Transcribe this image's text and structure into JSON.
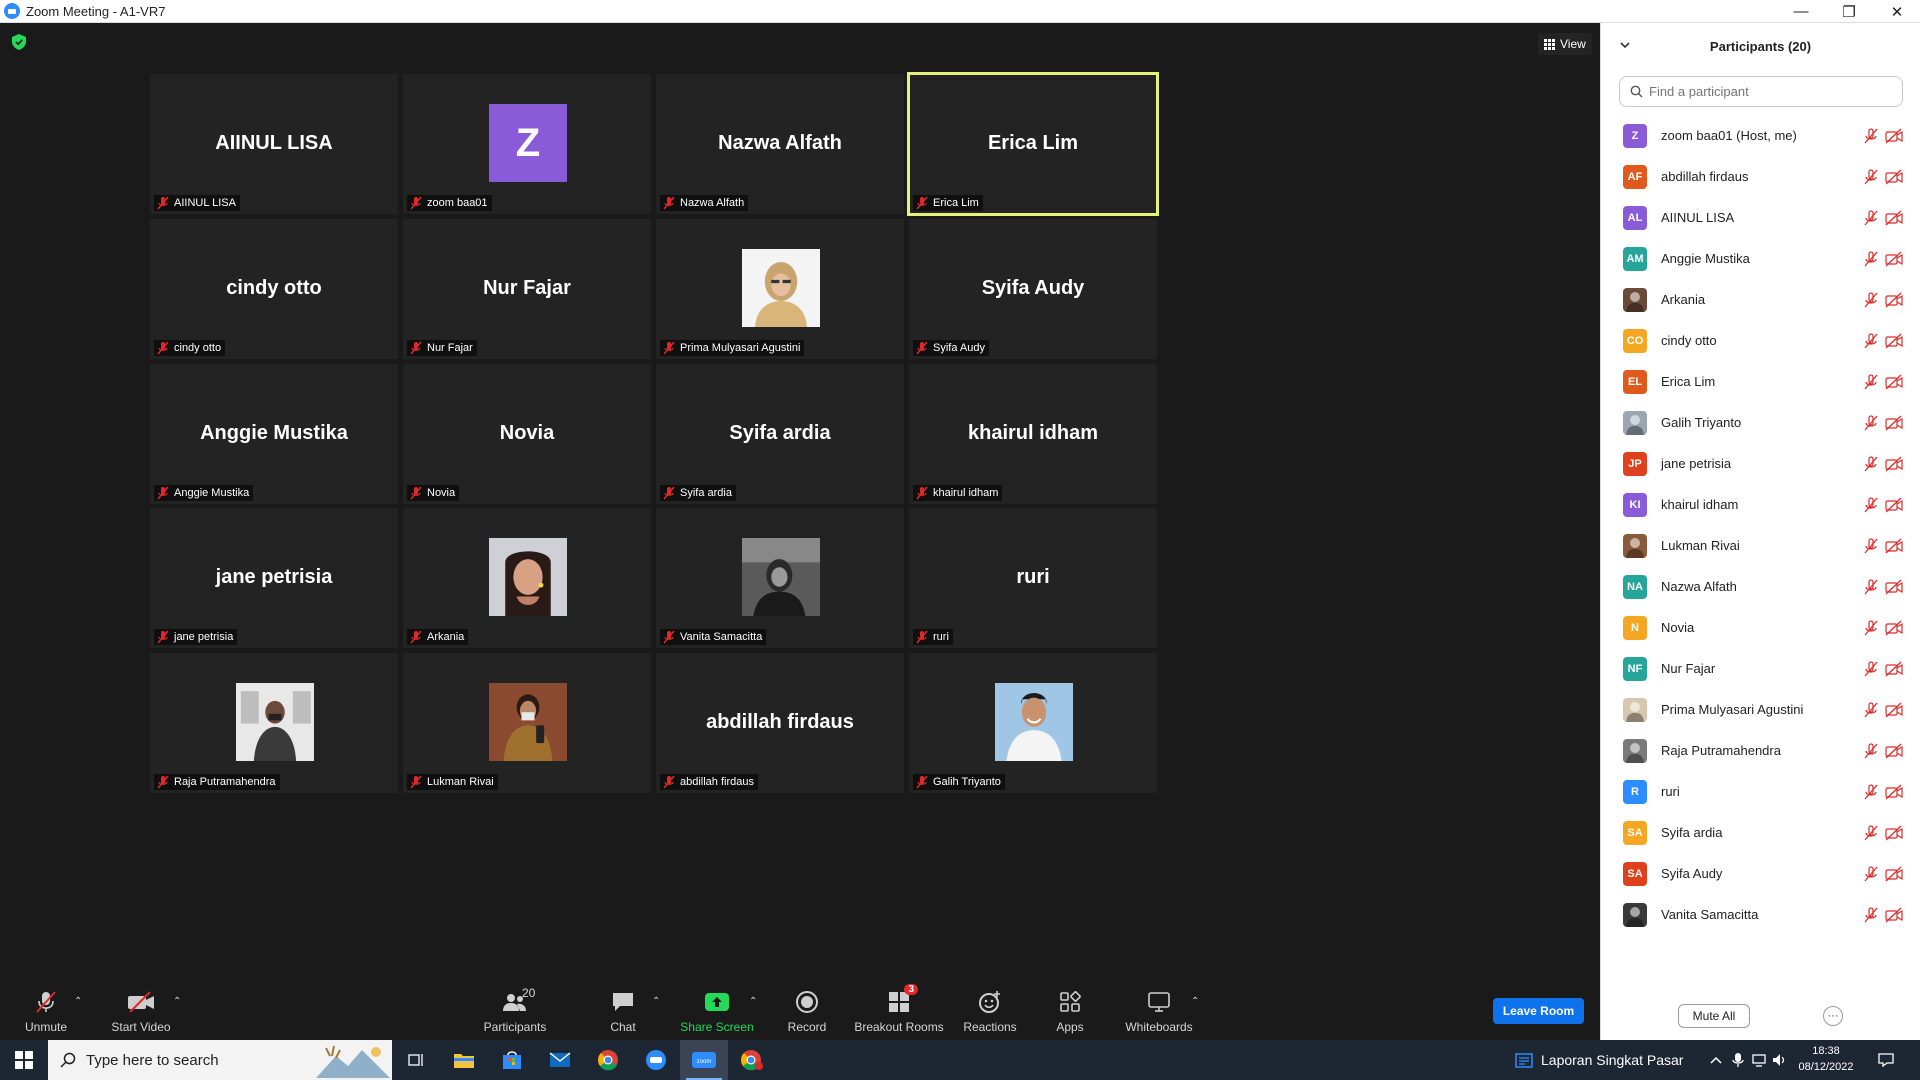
{
  "window": {
    "title": "Zoom Meeting - A1-VR7"
  },
  "view_label": "View",
  "tiles": [
    {
      "big": "AIINUL LISA",
      "label": "AIINUL LISA",
      "kind": "name"
    },
    {
      "big": "Z",
      "label": "zoom baa01",
      "kind": "avatar"
    },
    {
      "big": "Nazwa Alfath",
      "label": "Nazwa Alfath",
      "kind": "name"
    },
    {
      "big": "Erica Lim",
      "label": "Erica Lim",
      "kind": "name",
      "active": true
    },
    {
      "big": "cindy otto",
      "label": "cindy otto",
      "kind": "name"
    },
    {
      "big": "Nur Fajar",
      "label": "Nur Fajar",
      "kind": "name"
    },
    {
      "big": "",
      "label": "Prima Mulyasari Agustini",
      "kind": "photo"
    },
    {
      "big": "Syifa Audy",
      "label": "Syifa Audy",
      "kind": "name"
    },
    {
      "big": "Anggie Mustika",
      "label": "Anggie Mustika",
      "kind": "name"
    },
    {
      "big": "Novia",
      "label": "Novia",
      "kind": "name"
    },
    {
      "big": "Syifa ardia",
      "label": "Syifa ardia",
      "kind": "name"
    },
    {
      "big": "khairul idham",
      "label": "khairul idham",
      "kind": "name"
    },
    {
      "big": "jane petrisia",
      "label": "jane petrisia",
      "kind": "name"
    },
    {
      "big": "",
      "label": "Arkania",
      "kind": "photo"
    },
    {
      "big": "",
      "label": "Vanita Samacitta",
      "kind": "photo"
    },
    {
      "big": "ruri",
      "label": "ruri",
      "kind": "name"
    },
    {
      "big": "",
      "label": "Raja Putramahendra",
      "kind": "photo"
    },
    {
      "big": "",
      "label": "Lukman Rivai",
      "kind": "photo"
    },
    {
      "big": "abdillah firdaus",
      "label": "abdillah firdaus",
      "kind": "name"
    },
    {
      "big": "",
      "label": "Galih Triyanto",
      "kind": "photo"
    }
  ],
  "toolbar": {
    "unmute": "Unmute",
    "start_video": "Start Video",
    "participants": "Participants",
    "participants_count": "20",
    "chat": "Chat",
    "share_screen": "Share Screen",
    "record": "Record",
    "breakout_rooms": "Breakout Rooms",
    "breakout_badge": "3",
    "reactions": "Reactions",
    "apps": "Apps",
    "whiteboards": "Whiteboards",
    "leave_room": "Leave Room"
  },
  "panel": {
    "title": "Participants (20)",
    "search_placeholder": "Find a participant",
    "mute_all": "Mute All",
    "participants": [
      {
        "initials": "Z",
        "name": "zoom baa01 (Host, me)",
        "color": "#8a5bd8"
      },
      {
        "initials": "AF",
        "name": "abdillah firdaus",
        "color": "#e05a1e"
      },
      {
        "initials": "AL",
        "name": "AIINUL LISA",
        "color": "#8a5bd8"
      },
      {
        "initials": "AM",
        "name": "Anggie Mustika",
        "color": "#26a69a"
      },
      {
        "initials": "",
        "name": "Arkania",
        "color": "#6b4a3a"
      },
      {
        "initials": "CO",
        "name": "cindy otto",
        "color": "#f5a623"
      },
      {
        "initials": "EL",
        "name": "Erica Lim",
        "color": "#e05a1e"
      },
      {
        "initials": "",
        "name": "Galih Triyanto",
        "color": "#9aa6b2"
      },
      {
        "initials": "JP",
        "name": "jane petrisia",
        "color": "#e0401e"
      },
      {
        "initials": "KI",
        "name": "khairul idham",
        "color": "#8a5bd8"
      },
      {
        "initials": "",
        "name": "Lukman Rivai",
        "color": "#8a5a3a"
      },
      {
        "initials": "NA",
        "name": "Nazwa Alfath",
        "color": "#26a69a"
      },
      {
        "initials": "N",
        "name": "Novia",
        "color": "#f5a623"
      },
      {
        "initials": "NF",
        "name": "Nur Fajar",
        "color": "#26a69a"
      },
      {
        "initials": "",
        "name": "Prima Mulyasari Agustini",
        "color": "#d6c7b0"
      },
      {
        "initials": "",
        "name": "Raja Putramahendra",
        "color": "#7a7a7a"
      },
      {
        "initials": "R",
        "name": "ruri",
        "color": "#2d8cff"
      },
      {
        "initials": "SA",
        "name": "Syifa ardia",
        "color": "#f5a623"
      },
      {
        "initials": "SA",
        "name": "Syifa Audy",
        "color": "#e0401e"
      },
      {
        "initials": "",
        "name": "Vanita Samacitta",
        "color": "#3a3a3a"
      }
    ]
  },
  "taskbar": {
    "search_placeholder": "Type here to search",
    "open_doc": "Laporan Singkat Pasar",
    "time": "18:38",
    "date": "08/12/2022"
  }
}
